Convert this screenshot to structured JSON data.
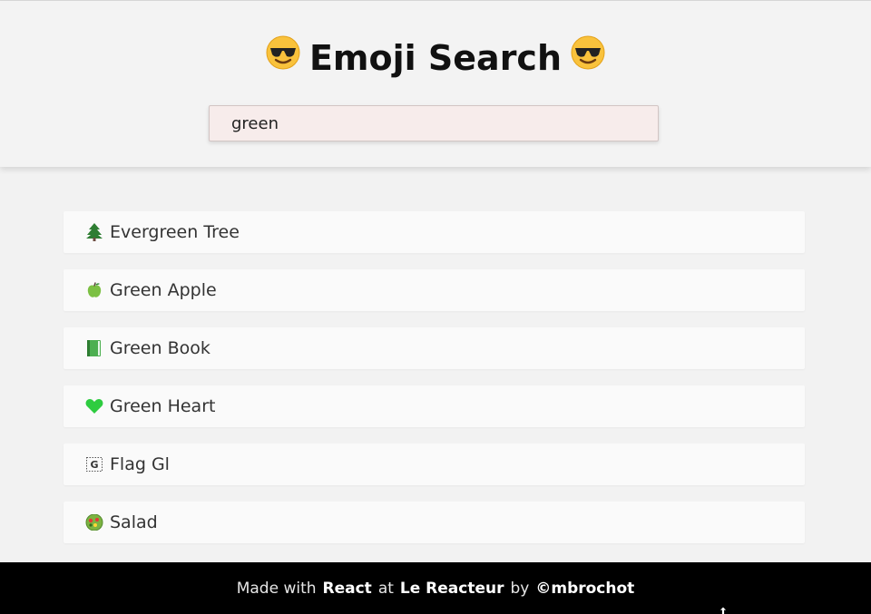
{
  "header": {
    "title": "Emoji Search",
    "title_emoji_icon": "smiling-face-with-sunglasses-icon"
  },
  "search": {
    "value": "green",
    "placeholder": ""
  },
  "results": [
    {
      "label": "Evergreen Tree",
      "icon": "evergreen-tree-icon"
    },
    {
      "label": "Green Apple",
      "icon": "green-apple-icon"
    },
    {
      "label": "Green Book",
      "icon": "green-book-icon"
    },
    {
      "label": "Green Heart",
      "icon": "green-heart-icon"
    },
    {
      "label": "Flag Gl",
      "icon": "flag-gl-icon"
    },
    {
      "label": "Salad",
      "icon": "salad-icon"
    }
  ],
  "footer": {
    "made_with": "Made with",
    "react": "React",
    "at": "at",
    "le_reacteur": "Le Reacteur",
    "by": "by",
    "author": "©mbrochot"
  },
  "colors": {
    "page_bg": "#f2f2f2",
    "search_bg": "#f7eceb",
    "footer_bg": "#000000"
  }
}
